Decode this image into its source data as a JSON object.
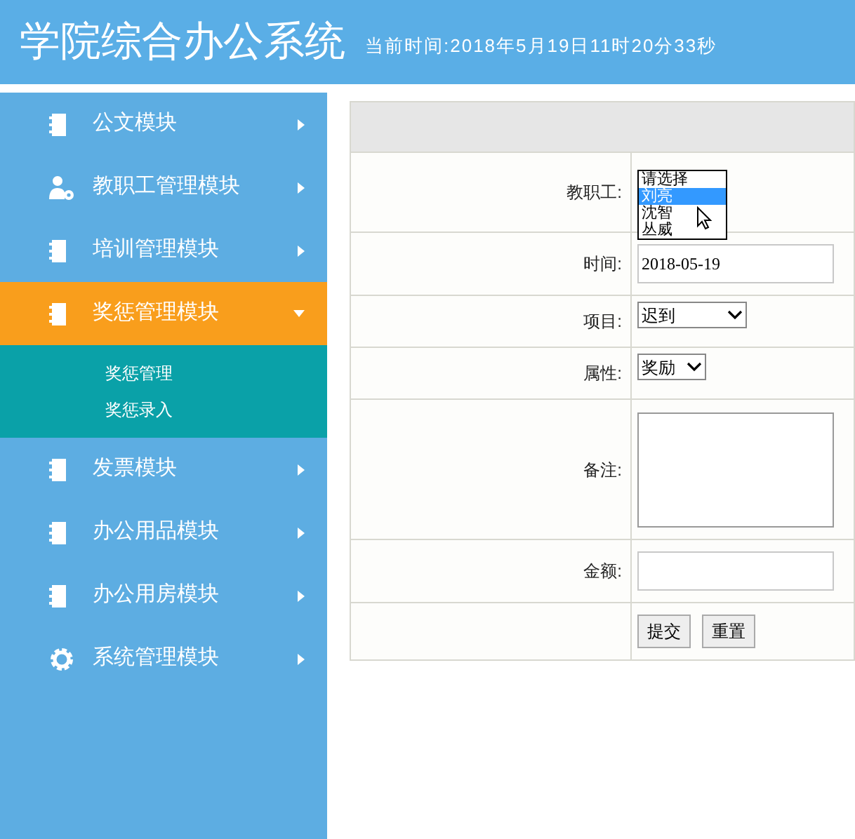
{
  "header": {
    "title": "学院综合办公系统",
    "clock": "当前时间:2018年5月19日11时20分33秒"
  },
  "sidebar": {
    "items": [
      {
        "label": "公文模块",
        "kind": "notebook",
        "expanded": false,
        "selected": false
      },
      {
        "label": "教职工管理模块",
        "kind": "staff",
        "expanded": false,
        "selected": false
      },
      {
        "label": "培训管理模块",
        "kind": "notebook",
        "expanded": false,
        "selected": false
      },
      {
        "label": "奖惩管理模块",
        "kind": "notebook",
        "expanded": true,
        "selected": true,
        "children": [
          {
            "label": "奖惩管理"
          },
          {
            "label": "奖惩录入"
          }
        ]
      },
      {
        "label": "发票模块",
        "kind": "notebook",
        "expanded": false,
        "selected": false
      },
      {
        "label": "办公用品模块",
        "kind": "notebook",
        "expanded": false,
        "selected": false
      },
      {
        "label": "办公用房模块",
        "kind": "notebook",
        "expanded": false,
        "selected": false
      },
      {
        "label": "系统管理模块",
        "kind": "settings",
        "expanded": false,
        "selected": false
      }
    ]
  },
  "form": {
    "rows": [
      {
        "kind": "listbox",
        "label": "教职工:",
        "options": [
          {
            "label": "请选择",
            "selected": false
          },
          {
            "label": "刘亮",
            "selected": true
          },
          {
            "label": "沈智",
            "selected": false
          },
          {
            "label": "丛威",
            "selected": false
          }
        ]
      },
      {
        "kind": "text",
        "label": "时间:",
        "value": "2018-05-19"
      },
      {
        "kind": "select",
        "label": "项目:",
        "value": "迟到"
      },
      {
        "kind": "select",
        "label": "属性:",
        "value": "奖励"
      },
      {
        "kind": "textarea",
        "label": "备注:"
      },
      {
        "kind": "text",
        "label": "金额:"
      },
      {
        "kind": "buttons",
        "buttons": [
          "提交",
          "重置"
        ]
      }
    ]
  }
}
